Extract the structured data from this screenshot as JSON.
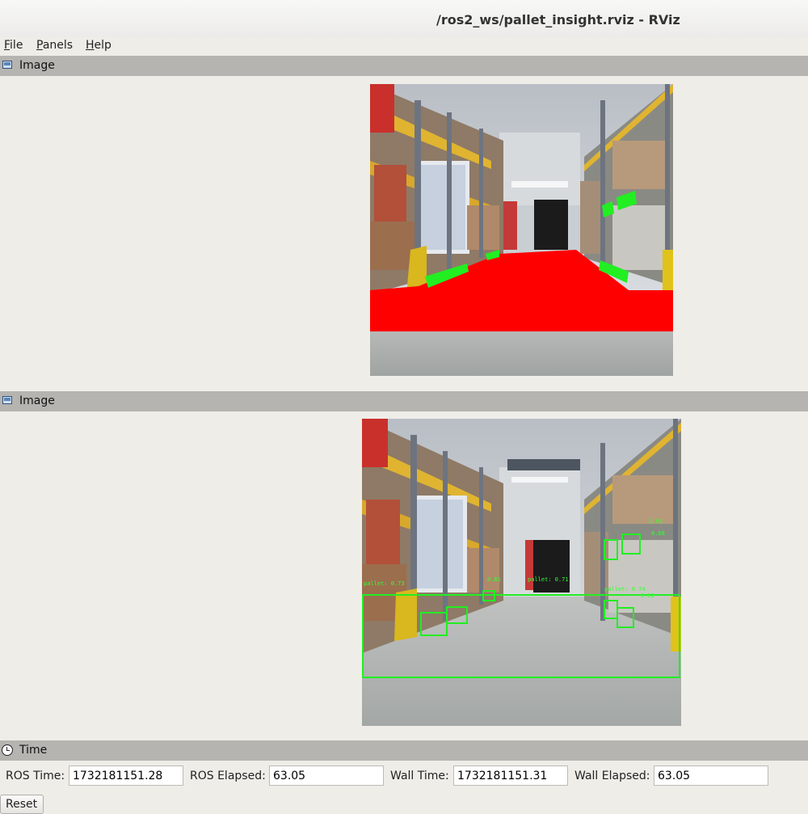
{
  "window": {
    "title": "/ros2_ws/pallet_insight.rviz - RViz"
  },
  "menu": [
    "File",
    "Panels",
    "Help"
  ],
  "panels": {
    "segmentation": {
      "title": "Image",
      "icon": "image-icon"
    },
    "detection": {
      "title": "Image",
      "icon": "image-icon",
      "labels": [
        "pallet: 0.73",
        "0.81",
        "pallet: 0.71",
        "0.66",
        "0.68",
        "pallet: 0.74",
        "0.62"
      ]
    },
    "time": {
      "title": "Time",
      "icon": "clock-icon"
    }
  },
  "time": {
    "ros_time_label": "ROS Time:",
    "ros_time": "1732181151.28",
    "ros_elapsed_label": "ROS Elapsed:",
    "ros_elapsed": "63.05",
    "wall_time_label": "Wall Time:",
    "wall_time": "1732181151.31",
    "wall_elapsed_label": "Wall Elapsed:",
    "wall_elapsed": "63.05",
    "reset_label": "Reset"
  },
  "colors": {
    "segmentation_floor": "#ff0000",
    "segmentation_pallet": "#22ee22",
    "detection_box": "#22ee22"
  }
}
